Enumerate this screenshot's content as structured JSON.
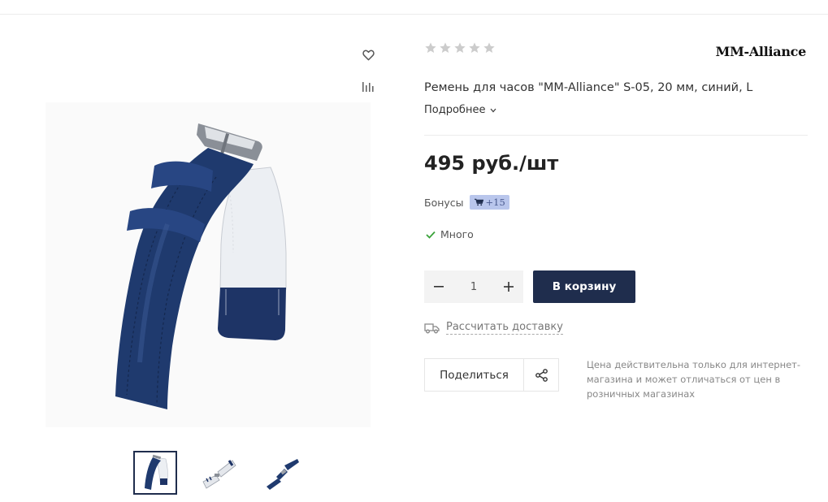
{
  "gallery": {
    "icons": {
      "favorite": "heart-icon",
      "compare": "bar-chart-icon"
    },
    "thumbnails": [
      "strap-angled",
      "strap-open",
      "strap-flat"
    ],
    "active_thumbnail": 0
  },
  "product": {
    "rating": 0,
    "rating_max": 5,
    "brand": "MM-Alliance",
    "title": "Ремень для часов \"MM-Alliance\" S-05, 20 мм, синий, L",
    "more_link": "Подробнее",
    "price": "495 руб./шт",
    "bonus_label": "Бонусы",
    "bonus_value": "+15",
    "stock": "Много"
  },
  "purchase": {
    "quantity": "1",
    "add_to_cart": "В корзину",
    "calc_delivery": "Рассчитать доставку",
    "share": "Поделиться",
    "price_note": "Цена действительна только для интернет-магазина и может отличаться от цен в розничных магазинах"
  },
  "colors": {
    "primary": "#1f2d4d",
    "bonus_bg": "#b9c6ec",
    "stock_check": "#3aa33a",
    "star_empty": "#cccccc"
  }
}
